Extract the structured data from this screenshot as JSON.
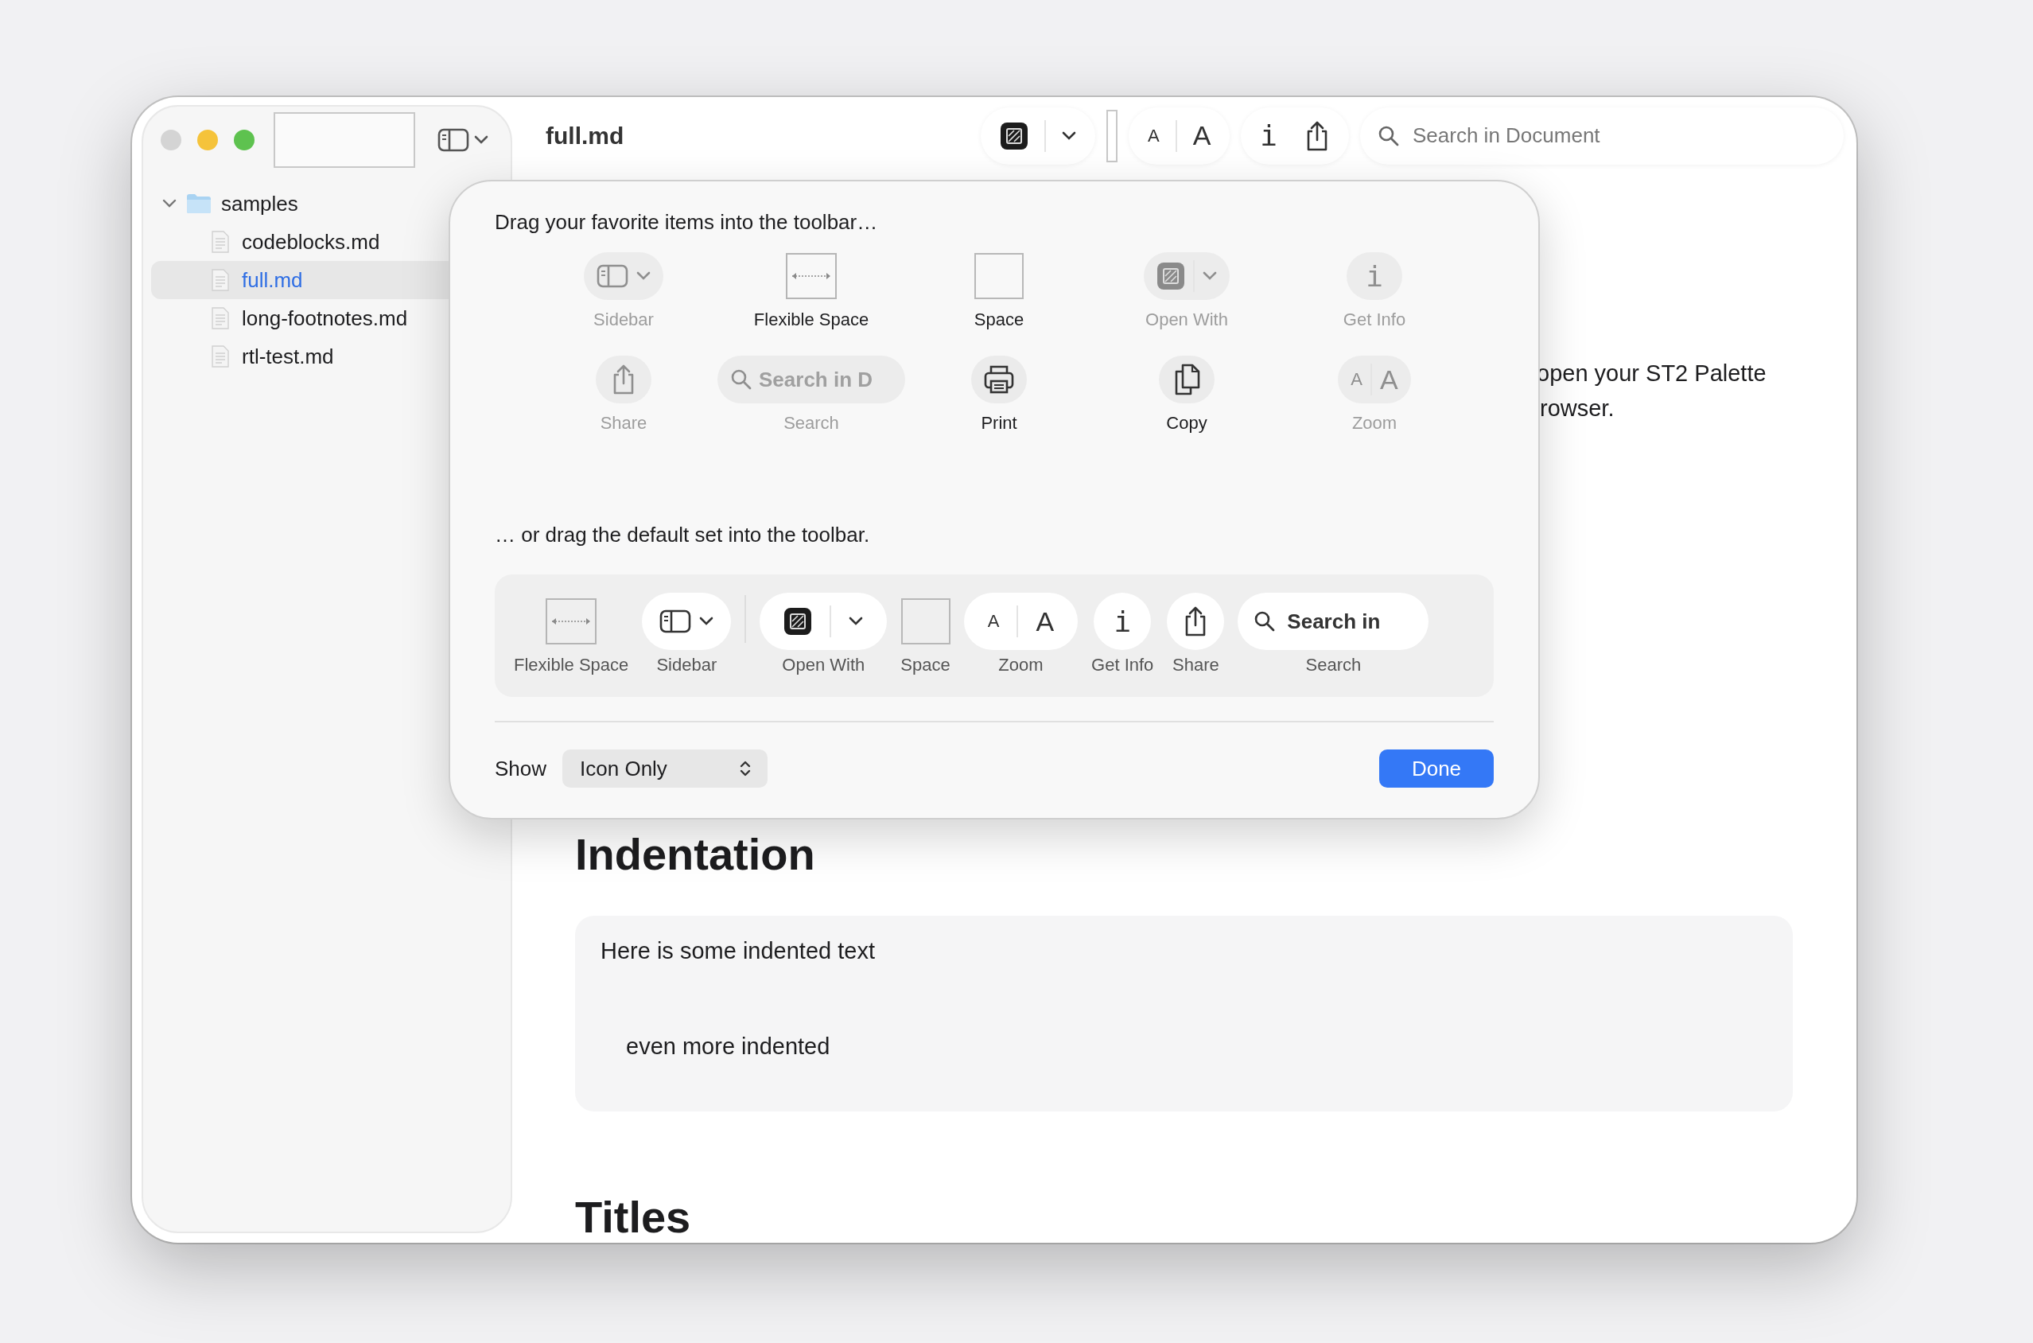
{
  "window": {
    "title": "full.md"
  },
  "sidebar": {
    "items": [
      {
        "name": "samples",
        "expanded": true,
        "selected": false,
        "children": [
          {
            "name": "codeblocks.md",
            "selected": false
          },
          {
            "name": "full.md",
            "selected": true
          },
          {
            "name": "long-footnotes.md",
            "selected": false
          },
          {
            "name": "rtl-test.md",
            "selected": false
          }
        ]
      }
    ]
  },
  "toolbar": {
    "zoom": {
      "small": "A",
      "large": "A"
    },
    "info": "i",
    "search": {
      "placeholder": "Search in Document"
    }
  },
  "document": {
    "fragments": [
      "open your ST2 Palette",
      "rowser."
    ],
    "sections": [
      {
        "kind": "heading",
        "text": "Indentation"
      },
      {
        "kind": "code",
        "lines": [
          {
            "text": "Here is some indented text",
            "indented": false
          },
          {
            "text": "even more indented",
            "indented": true
          }
        ]
      },
      {
        "kind": "heading",
        "text": "Titles"
      }
    ]
  },
  "customize_sheet": {
    "heading": "Drag your favorite items into the toolbar…",
    "palette": [
      {
        "kind": "sidebar",
        "label": "Sidebar",
        "disabled": true
      },
      {
        "kind": "flexible-space",
        "label": "Flexible Space",
        "disabled": false
      },
      {
        "kind": "space",
        "label": "Space",
        "disabled": false
      },
      {
        "kind": "open-with",
        "label": "Open With",
        "disabled": true
      },
      {
        "kind": "info",
        "label": "Get Info",
        "glyph": "i",
        "disabled": true
      },
      {
        "kind": "share",
        "label": "Share",
        "disabled": true
      },
      {
        "kind": "search",
        "label": "Search",
        "field_text": "Search in D",
        "disabled": true
      },
      {
        "kind": "print",
        "label": "Print",
        "disabled": false
      },
      {
        "kind": "copy",
        "label": "Copy",
        "disabled": false
      },
      {
        "kind": "zoom",
        "label": "Zoom",
        "small": "A",
        "large": "A",
        "disabled": true
      }
    ],
    "default_heading": "… or drag the default set into the toolbar.",
    "default_set": [
      {
        "kind": "flexible-space",
        "label": "Flexible Space"
      },
      {
        "kind": "sidebar",
        "label": "Sidebar"
      },
      {
        "kind": "separator"
      },
      {
        "kind": "open-with",
        "label": "Open With"
      },
      {
        "kind": "space",
        "label": "Space"
      },
      {
        "kind": "zoom",
        "label": "Zoom",
        "small": "A",
        "large": "A"
      },
      {
        "kind": "info",
        "label": "Get Info",
        "glyph": "i"
      },
      {
        "kind": "share",
        "label": "Share"
      },
      {
        "kind": "search",
        "label": "Search",
        "field_text": "Search in"
      }
    ],
    "show": {
      "label": "Show",
      "value": "Icon Only"
    },
    "done": "Done"
  }
}
